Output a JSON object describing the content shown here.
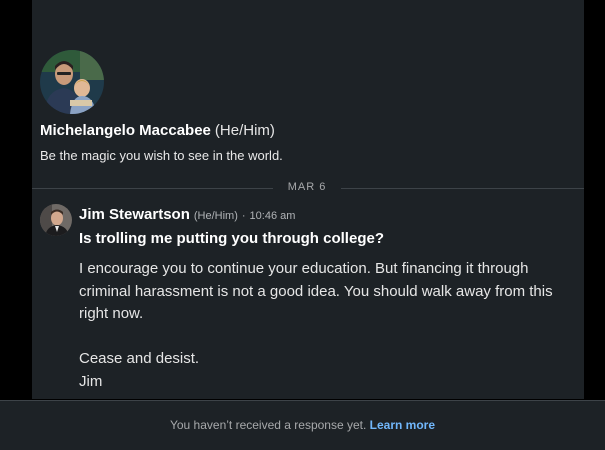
{
  "profile": {
    "name": "Michelangelo Maccabee",
    "pronouns": "(He/Him)",
    "headline": "Be the magic you wish to see in the world."
  },
  "thread": {
    "date_divider": "MAR 6"
  },
  "message": {
    "author": "Jim Stewartson",
    "pronouns": "(He/Him)",
    "separator": "·",
    "time": "10:46 am",
    "subject": "Is trolling me putting you through college?",
    "body_lines": [
      "I encourage you to continue your education. But financing it through",
      "criminal harassment is not a good idea. You should walk away from this",
      "right now.",
      "",
      "Cease and desist.",
      "Jim"
    ]
  },
  "footer": {
    "status_text": "You haven’t received a response yet.",
    "link_label": "Learn more"
  },
  "colors": {
    "background": "#000000",
    "panel": "#1d2226",
    "link": "#71b7fb",
    "muted_text": "#a7a9ab"
  }
}
